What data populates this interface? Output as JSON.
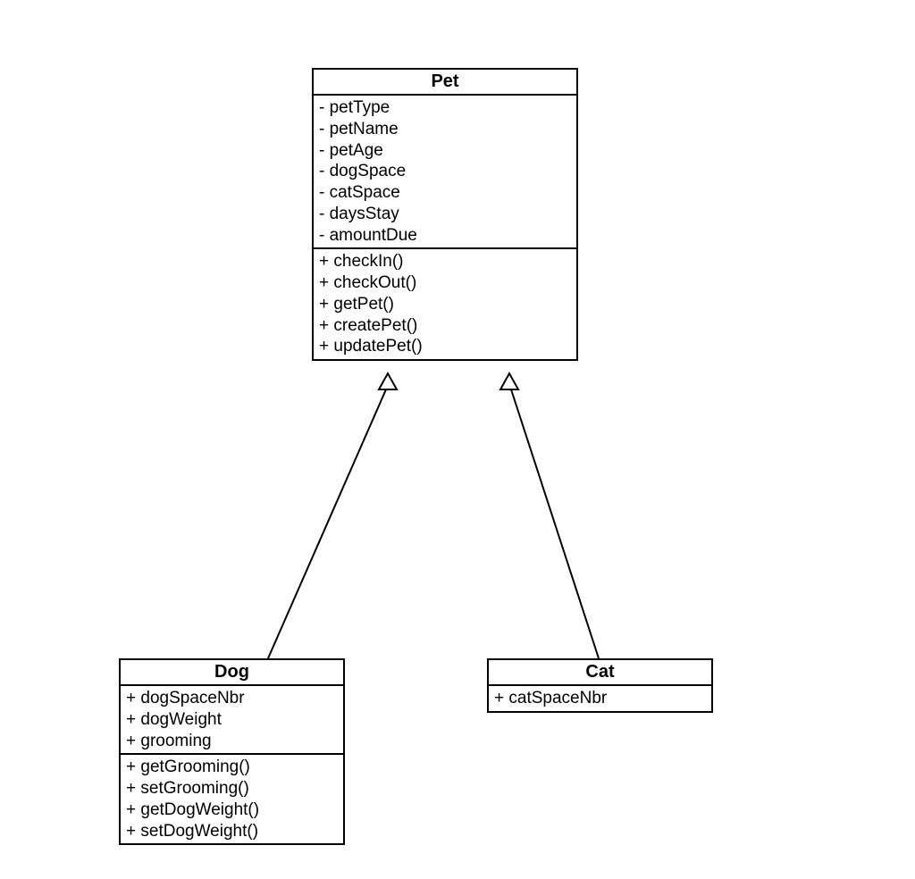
{
  "classes": {
    "pet": {
      "name": "Pet",
      "attributes": [
        "- petType",
        "- petName",
        "- petAge",
        "- dogSpace",
        "- catSpace",
        "- daysStay",
        "- amountDue"
      ],
      "methods": [
        "+ checkIn()",
        "+ checkOut()",
        "+ getPet()",
        "+ createPet()",
        "+ updatePet()"
      ]
    },
    "dog": {
      "name": "Dog",
      "attributes": [
        "+ dogSpaceNbr",
        "+ dogWeight",
        "+ grooming"
      ],
      "methods": [
        "+ getGrooming()",
        "+ setGrooming()",
        "+ getDogWeight()",
        "+ setDogWeight()"
      ]
    },
    "cat": {
      "name": "Cat",
      "attributes": [
        "+ catSpaceNbr"
      ],
      "methods": []
    }
  },
  "relationships": [
    {
      "type": "inheritance",
      "from": "dog",
      "to": "pet"
    },
    {
      "type": "inheritance",
      "from": "cat",
      "to": "pet"
    }
  ]
}
